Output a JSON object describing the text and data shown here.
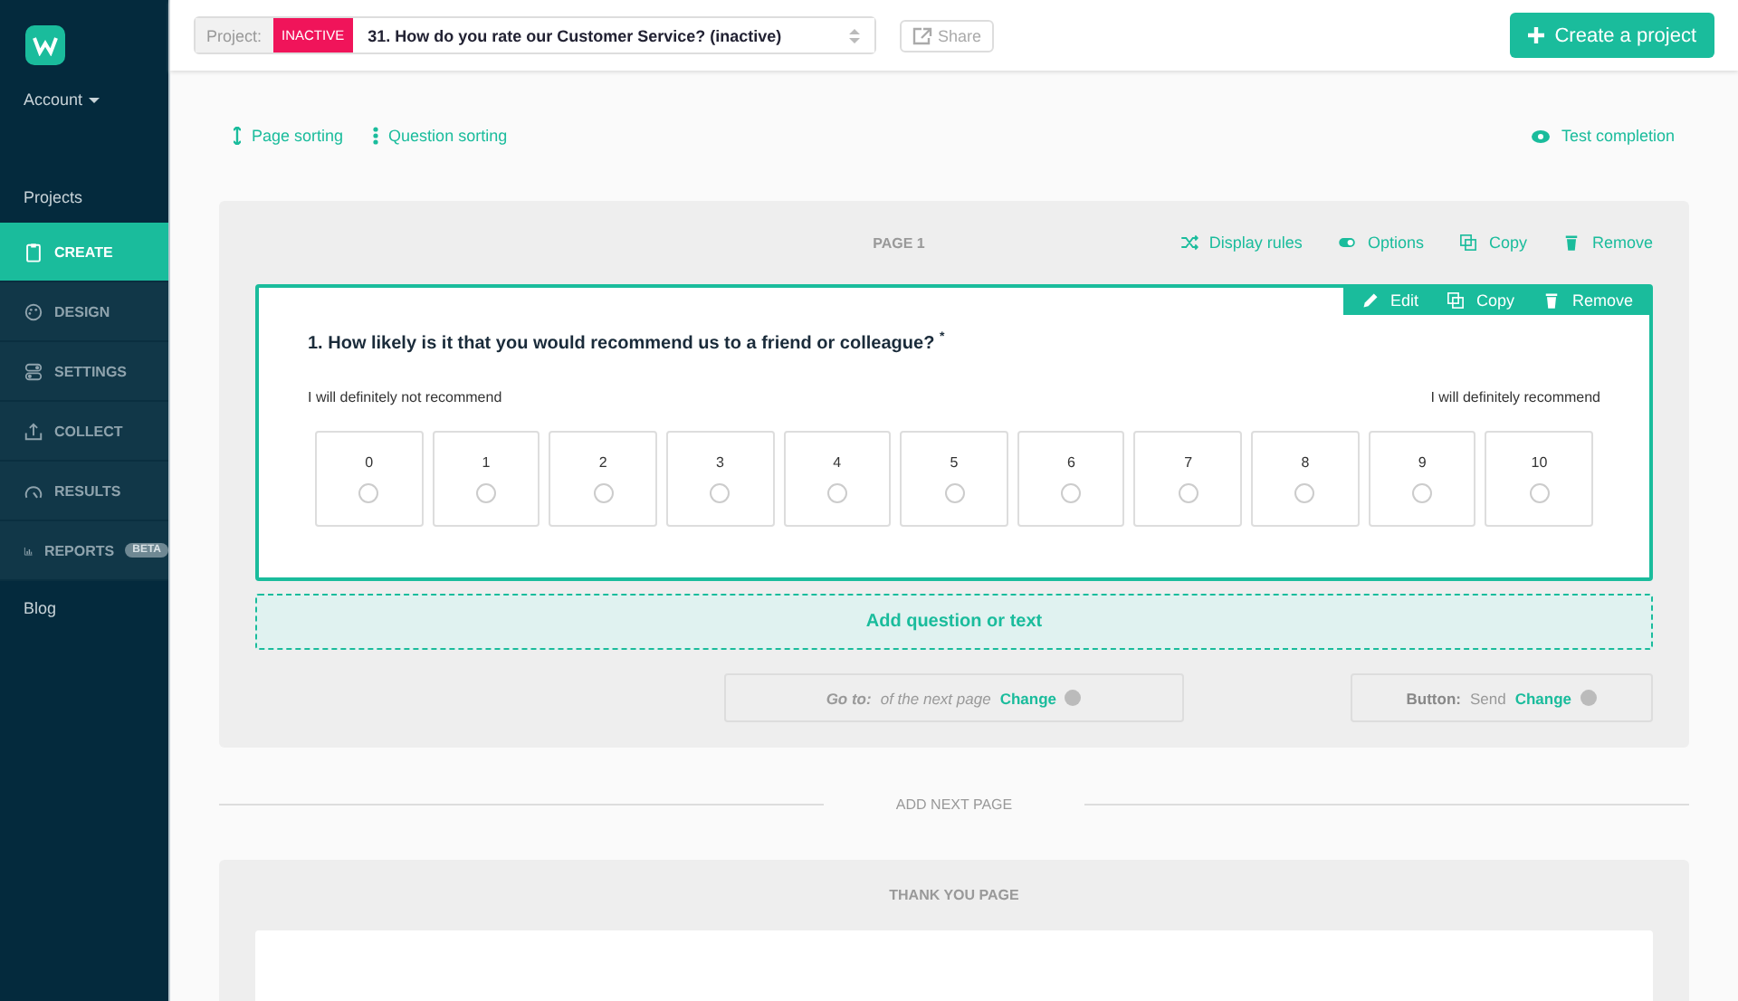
{
  "sidebar": {
    "account": "Account",
    "projects": "Projects",
    "items": [
      {
        "label": "CREATE",
        "selected": true
      },
      {
        "label": "DESIGN",
        "selected": false
      },
      {
        "label": "SETTINGS",
        "selected": false
      },
      {
        "label": "COLLECT",
        "selected": false
      },
      {
        "label": "RESULTS",
        "selected": false
      },
      {
        "label": "REPORTS",
        "selected": false,
        "badge": "BETA"
      }
    ],
    "blog": "Blog"
  },
  "header": {
    "project_label": "Project:",
    "status": "INACTIVE",
    "project": "31. How do you rate our Customer Service? (inactive)",
    "share": "Share",
    "create": "Create a project"
  },
  "toolbar": {
    "page_sorting": "Page sorting",
    "question_sorting": "Question sorting",
    "test_completion": "Test completion"
  },
  "page": {
    "title": "PAGE 1",
    "actions": [
      "Display rules",
      "Options",
      "Copy",
      "Remove"
    ],
    "question": {
      "title": "1. How likely is it that you would recommend us to a friend or colleague?",
      "required_mark": "*",
      "low_label": "I will definitely not recommend",
      "high_label": "I will definitely recommend",
      "actions": [
        "Edit",
        "Copy",
        "Remove"
      ],
      "options": [
        {
          "label": "0",
          "selected": false
        },
        {
          "label": "1",
          "selected": false
        },
        {
          "label": "2",
          "selected": false
        },
        {
          "label": "3",
          "selected": false
        },
        {
          "label": "4",
          "selected": false
        },
        {
          "label": "5",
          "selected": false
        },
        {
          "label": "6",
          "selected": false
        },
        {
          "label": "7",
          "selected": false
        },
        {
          "label": "8",
          "selected": false
        },
        {
          "label": "9",
          "selected": false
        },
        {
          "label": "10",
          "selected": false
        }
      ]
    },
    "add_question": "Add question or text",
    "goto": {
      "label": "Go to:",
      "value": "of the next page",
      "change": "Change"
    },
    "button": {
      "label": "Button:",
      "value": "Send",
      "change": "Change"
    }
  },
  "add_next_page": "ADD NEXT PAGE",
  "thank_you": {
    "title": "THANK YOU PAGE"
  }
}
